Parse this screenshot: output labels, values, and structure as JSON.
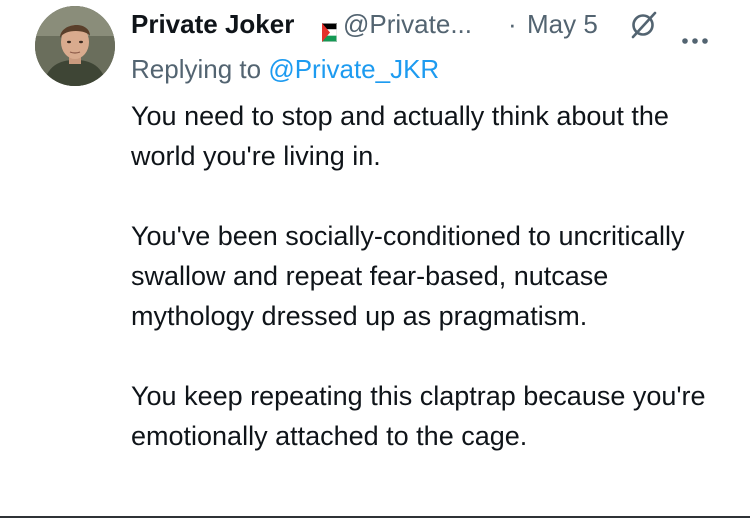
{
  "tweet": {
    "author": {
      "display_name": "Private Joker",
      "handle": "@Private...",
      "flag_icon": "palestine-flag-icon"
    },
    "separator": "·",
    "date": "May 5",
    "icons": {
      "grok": "grok-icon",
      "more": "more-options-icon"
    },
    "reply": {
      "prefix": "Replying to",
      "target": "@Private_JKR"
    },
    "paragraphs": [
      "You need to stop and actually think about the world you're living in.",
      "You've been socially-conditioned to uncritically swallow and repeat fear-based, nutcase mythology dressed up as pragmatism.",
      "You keep repeating this claptrap because you're emotionally attached to the cage."
    ]
  },
  "colors": {
    "text": "#0f1419",
    "secondary": "#536471",
    "link": "#1d9bf0",
    "background": "#ffffff"
  }
}
